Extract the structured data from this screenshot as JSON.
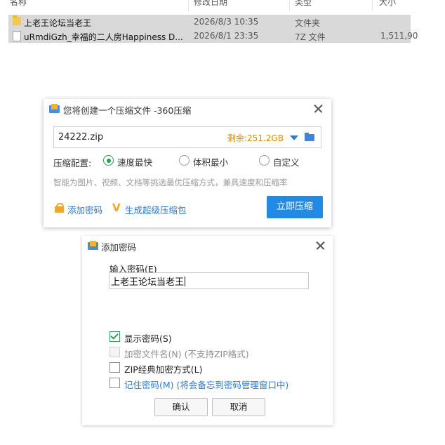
{
  "file_list": {
    "headers": {
      "name": "名称",
      "date": "修改日期",
      "type": "类型",
      "size": "大小"
    },
    "rows": [
      {
        "icon": "folder-icon",
        "name": "上老王论坛当老王",
        "date": "2026/8/3 10:35",
        "type": "文件夹",
        "size": ""
      },
      {
        "icon": "archive-file-icon",
        "name": "uRmdiGzh_幸福的二人房Happiness D...",
        "date": "2026/8/1 23:35",
        "type": "7Z 文件",
        "size": "1,511,90"
      }
    ]
  },
  "compress_dialog": {
    "title": "您将创建一个压缩文件 -360压缩",
    "path_value": "24222.zip",
    "space_label": "剩余:251.2GB",
    "config_label": "压缩配置:",
    "options": [
      "速度最快",
      "体积最小",
      "自定义"
    ],
    "selected_option": "速度最快",
    "hint": "智能为图片、视频、文档等挑选最优压缩方式，兼具速度和压缩率",
    "add_password_link": "添加密码",
    "super_compress_link": "生成超级压缩包",
    "compress_button": "立即压缩",
    "colors": {
      "accent": "#1f8be6",
      "space": "#e08b00",
      "radio": "#2b9a4a"
    }
  },
  "password_dialog": {
    "title": "添加密码",
    "input_label": "输入密码(E)",
    "password_value": "上老王论坛当老王",
    "checkboxes": [
      {
        "label": "显示密码(S)",
        "checked": true,
        "disabled": false
      },
      {
        "label": "加密文件名(N) (不支持ZIP格式)",
        "checked": false,
        "disabled": true
      },
      {
        "label": "ZIP经典加密方式(L)",
        "checked": false,
        "disabled": false
      },
      {
        "label": "记住密码(M) (将会备忘到密码管理窗口中)",
        "checked": false,
        "disabled": false
      }
    ],
    "ok_button": "确认",
    "cancel_button": "取消"
  }
}
